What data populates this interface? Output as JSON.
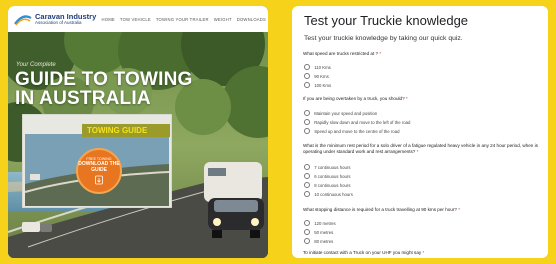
{
  "left": {
    "logo": {
      "name": "Caravan Industry",
      "sub": "Association of Australia"
    },
    "nav": [
      "HOME",
      "TOW VEHICLE",
      "TOWING YOUR TRAILER",
      "WEIGHT",
      "DOWNLOADS"
    ],
    "hero": {
      "kicker": "Your Complete",
      "title": "GUIDE TO TOWING IN AUSTRALIA"
    },
    "book_tag": "TOWING GUIDE",
    "badge": {
      "top": "FREE TOWING",
      "main": "DOWNLOAD THE GUIDE"
    }
  },
  "right": {
    "title": "Test your Truckie knowledge",
    "description": "Test your truckie knowledge by taking our quick quiz.",
    "questions": [
      {
        "text": "What speed are trucks restricted at ?",
        "required": "*",
        "options": [
          "110 Kms",
          "90 Kms",
          "100 Kms"
        ]
      },
      {
        "text": "If you are being overtaken by a truck, you should?",
        "required": "*",
        "options": [
          "Maintain your speed and position",
          "Rapidly slow down and move to the left of the road",
          "Speed up and move to the centre of the road"
        ]
      },
      {
        "text": "What is the minimum rest period for a solo driver of a fatigue regulated heavy vehicle in any 24 hour period, when is operating under standard work and rest arrangements?",
        "required": "*",
        "options": [
          "7 continuous hours",
          "6 continuous hours",
          "8 continuous hours",
          "10 continuous hours"
        ]
      },
      {
        "text": "What stopping distance is required for a truck travelling at 90 kms per hour?",
        "required": "*",
        "options": [
          "120 metres",
          "50 metres",
          "80 metres"
        ]
      },
      {
        "text": "To initiate contact with a Truck on your UHF you might say",
        "required": "*",
        "options": []
      }
    ]
  },
  "colors": {
    "background": "#f6d21a",
    "accent_orange": "#e8751f",
    "brand_blue": "#1f3e7a"
  }
}
